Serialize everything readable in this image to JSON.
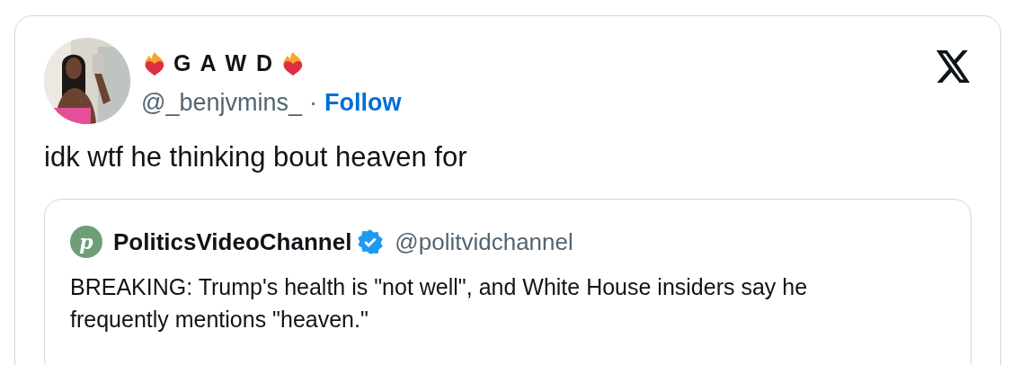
{
  "author": {
    "display_name": "G A W D",
    "handle": "@_benjvmins_",
    "separator": "·",
    "follow": "Follow"
  },
  "text": "idk wtf he thinking bout heaven for",
  "quoted": {
    "logo": {
      "letter": "p",
      "color": "#6e9e78"
    },
    "name": "PoliticsVideoChannel",
    "verified": true,
    "handle": "@politvidchannel",
    "text": "BREAKING: Trump's health is \"not well\", and White House insiders say he frequently mentions \"heaven.\""
  }
}
